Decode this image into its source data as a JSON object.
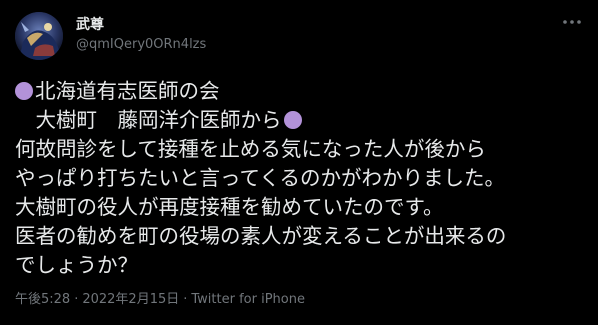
{
  "author": {
    "display_name": "武尊",
    "handle": "@qmIQery0ORn4lzs",
    "avatar_icon": "profile-avatar"
  },
  "more_icon": "more-horizontal-icon",
  "bullet_color": "#b392d9",
  "tweet": {
    "line1": "北海道有志医師の会",
    "line2": "　大樹町　藤岡洋介医師から",
    "line3": "何故問診をして接種を止める気になった人が後から",
    "line4": "やっぱり打ちたいと言ってくるのかがわかりました。",
    "line5": "大樹町の役人が再度接種を勧めていたのです。",
    "line6": "医者の勧めを町の役場の素人が変えることが出来るの",
    "line7": "でしょうか？"
  },
  "meta": {
    "time": "午後5:28",
    "separator1": "·",
    "date": "2022年2月15日",
    "separator2": "·",
    "source": "Twitter for iPhone"
  }
}
